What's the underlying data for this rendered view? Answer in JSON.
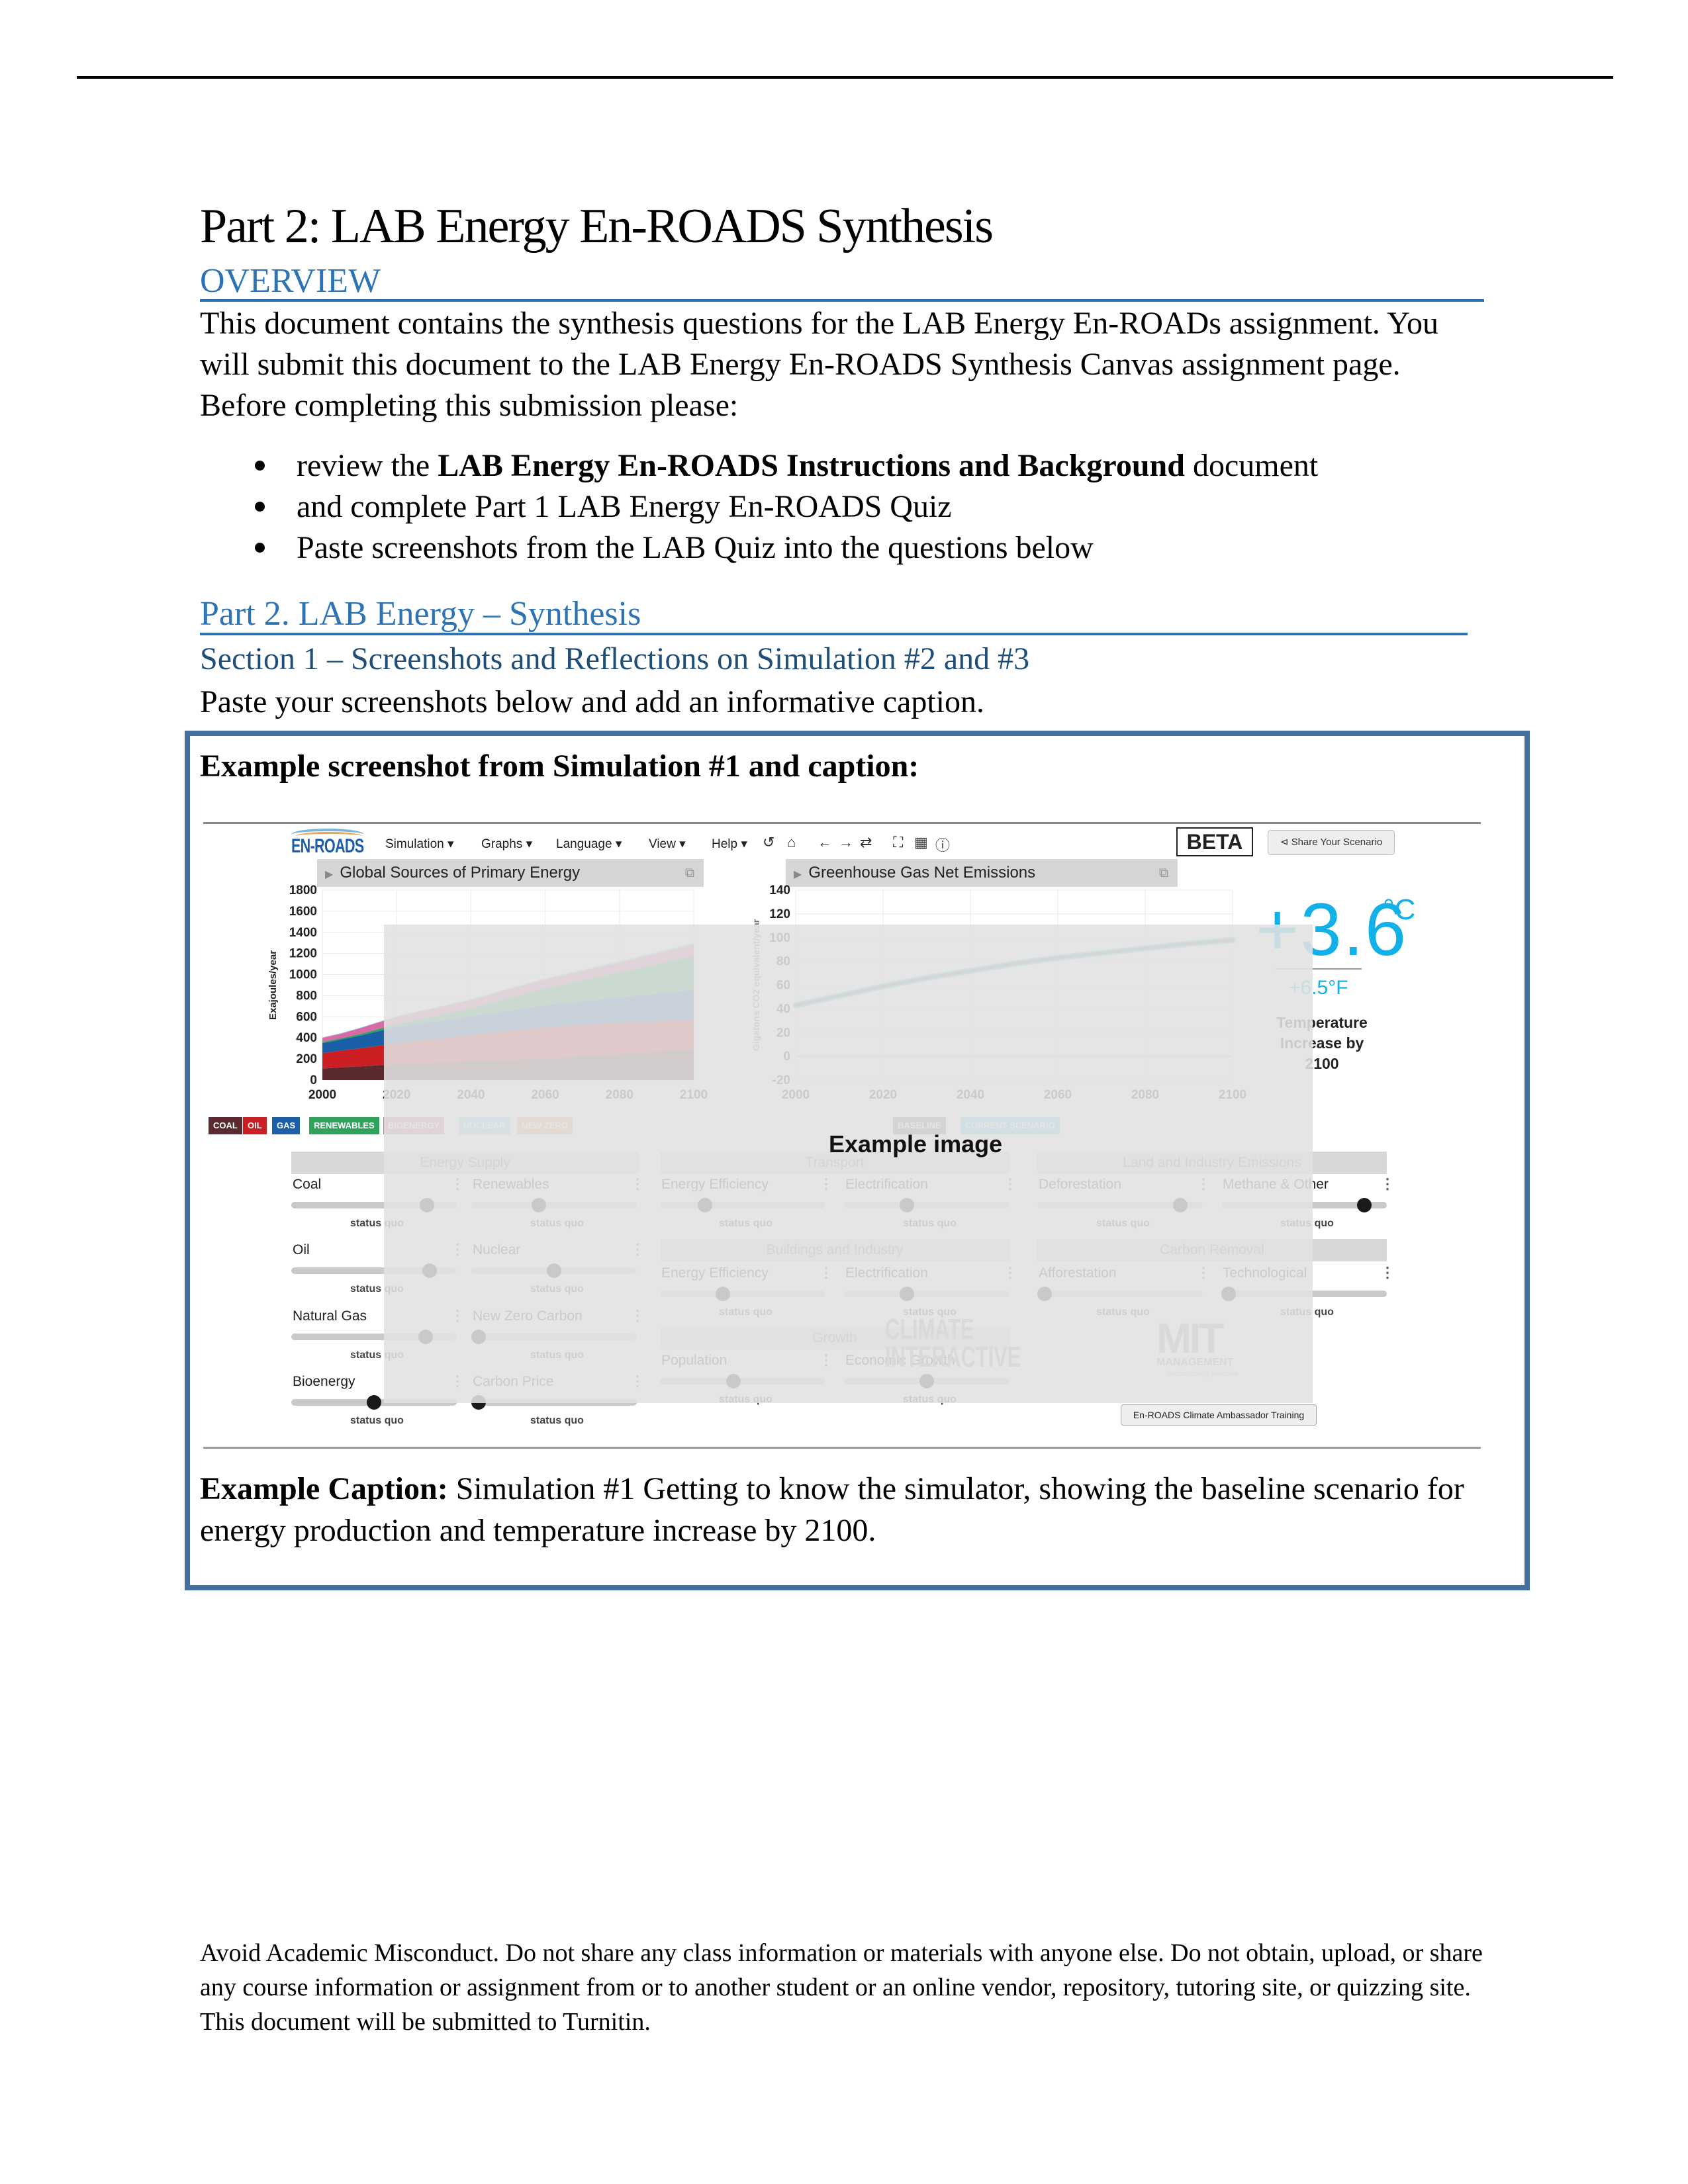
{
  "document": {
    "title": "Part 2: LAB Energy En-ROADS Synthesis",
    "overview_heading": "OVERVIEW",
    "overview_lines": [
      "This document contains the synthesis questions for the LAB Energy En-ROADs assignment. You",
      "will submit this document to the LAB Energy En-ROADS Synthesis Canvas assignment page.",
      "Before completing this submission please:"
    ],
    "bullets": [
      {
        "pre": "review the ",
        "bold": "LAB Energy En-ROADS Instructions and Background",
        "post": " document"
      },
      {
        "pre": "and complete Part 1 LAB Energy En-ROADS Quiz",
        "bold": "",
        "post": ""
      },
      {
        "pre": "Paste screenshots from the LAB Quiz into the questions below",
        "bold": "",
        "post": ""
      }
    ],
    "part2_heading": "Part 2. LAB Energy – Synthesis",
    "section1_heading": "Section 1 – Screenshots and Reflections on Simulation #2 and #3",
    "instruction": "Paste your screenshots below and add an informative caption.",
    "box": {
      "heading": "Example screenshot from Simulation #1 and caption:",
      "caption_label": "Example Caption:",
      "caption_text": " Simulation #1 Getting to know the simulator, showing the baseline scenario for energy production and temperature increase by 2100."
    },
    "footer": "Avoid Academic Misconduct. Do not share any class information or materials with anyone else. Do not obtain, upload, or share any course information or assignment from or to another student or an online vendor, repository, tutoring site, or quizzing site. This document will be submitted to Turnitin."
  },
  "screenshot": {
    "logo": "EN-ROADS",
    "menus": [
      "Simulation ▾",
      "Graphs ▾",
      "Language ▾",
      "View ▾",
      "Help ▾"
    ],
    "toolbar_icons": [
      {
        "name": "undo-icon",
        "glyph": "↺"
      },
      {
        "name": "home-icon",
        "glyph": "⌂"
      },
      {
        "name": "arrow-left-icon",
        "glyph": "←"
      },
      {
        "name": "arrow-right-icon",
        "glyph": "→"
      },
      {
        "name": "refresh-icon",
        "glyph": "⇄"
      },
      {
        "name": "fullscreen-icon",
        "glyph": "⛶"
      },
      {
        "name": "grid-icon",
        "glyph": "▦"
      },
      {
        "name": "info-icon",
        "glyph": "ⓘ"
      }
    ],
    "beta": "BETA",
    "share_button": "Share Your Scenario",
    "example_watermark": "Example image",
    "temperature": {
      "celsius": "+3.6",
      "celsius_unit": "°C",
      "fahrenheit": "+6.5°F",
      "label": "Temperature Increase by 2100"
    },
    "legend_energy": [
      {
        "label": "COAL",
        "color": "#5a2a2e"
      },
      {
        "label": "OIL",
        "color": "#cc1f24"
      },
      {
        "label": "GAS",
        "color": "#1b5fa8"
      },
      {
        "label": "RENEWABLES",
        "color": "#2fa35a"
      },
      {
        "label": "BIOENERGY",
        "color": "#d96aa6"
      },
      {
        "label": "NUCLEAR",
        "color": "#8dd3e6"
      },
      {
        "label": "NEW ZERO",
        "color": "#f29b5c"
      }
    ],
    "legend_emissions": [
      {
        "label": "BASELINE",
        "color": "#6e6e6e"
      },
      {
        "label": "CURRENT SCENARIO",
        "color": "#5cc3ea"
      }
    ],
    "groups": [
      {
        "title": "Energy Supply",
        "controls": [
          {
            "label": "Coal",
            "status": "status quo",
            "value": 0.85
          },
          {
            "label": "Renewables",
            "status": "status quo",
            "value": 0.4
          },
          {
            "label": "Oil",
            "status": "status quo",
            "value": 0.87
          },
          {
            "label": "Nuclear",
            "status": "status quo",
            "value": 0.5
          },
          {
            "label": "Natural Gas",
            "status": "status quo",
            "value": 0.84
          },
          {
            "label": "New Zero Carbon",
            "status": "status quo",
            "value": 0.0
          },
          {
            "label": "Bioenergy",
            "status": "status quo",
            "value": 0.5
          },
          {
            "label": "Carbon Price",
            "status": "status quo",
            "value": 0.0
          }
        ]
      },
      {
        "title": "Transport",
        "controls": [
          {
            "label": "Energy Efficiency",
            "status": "status quo",
            "value": 0.25
          },
          {
            "label": "Electrification",
            "status": "status quo",
            "value": 0.37
          }
        ]
      },
      {
        "title": "Buildings and Industry",
        "controls": [
          {
            "label": "Energy Efficiency",
            "status": "status quo",
            "value": 0.37
          },
          {
            "label": "Electrification",
            "status": "status quo",
            "value": 0.37
          }
        ]
      },
      {
        "title": "Growth",
        "controls": [
          {
            "label": "Population",
            "status": "status quo",
            "value": 0.44
          },
          {
            "label": "Economic Growth",
            "status": "status quo",
            "value": 0.5
          }
        ]
      },
      {
        "title": "Land and Industry Emissions",
        "controls": [
          {
            "label": "Deforestation",
            "status": "status quo",
            "value": 0.9
          },
          {
            "label": "Methane & Other",
            "status": "status quo",
            "value": 0.9
          }
        ]
      },
      {
        "title": "Carbon Removal",
        "controls": [
          {
            "label": "Afforestation",
            "status": "status quo",
            "value": 0.0
          },
          {
            "label": "Technological",
            "status": "status quo",
            "value": 0.0
          }
        ]
      }
    ],
    "logos": {
      "climate_interactive": "CLIMATE INTERACTIVE",
      "mit": "MIT",
      "mit_sub": "MANAGEMENT",
      "mit_sub2": "Sustainability Initiative"
    },
    "ambassador_button": "En-ROADS Climate Ambassador Training"
  },
  "chart_data": [
    {
      "type": "area",
      "title": "Global Sources of Primary Energy",
      "xlabel": "",
      "ylabel": "Exajoules/year",
      "x": [
        2000,
        2005,
        2010,
        2020,
        2040,
        2060,
        2080,
        2100
      ],
      "xticks": [
        "2000",
        "2020",
        "2040",
        "2060",
        "2080",
        "2100"
      ],
      "yticks": [
        "1800",
        "1600",
        "1400",
        "1200",
        "1000",
        "800",
        "600",
        "400",
        "200",
        "0"
      ],
      "xlim": [
        2000,
        2100
      ],
      "ylim": [
        0,
        1800
      ],
      "stacked": true,
      "series": [
        {
          "name": "Coal",
          "values": [
            110,
            120,
            130,
            150,
            175,
            205,
            245,
            290
          ]
        },
        {
          "name": "Oil",
          "values": [
            145,
            160,
            170,
            200,
            255,
            295,
            300,
            285
          ]
        },
        {
          "name": "Gas",
          "values": [
            95,
            105,
            120,
            155,
            175,
            210,
            240,
            280
          ]
        },
        {
          "name": "Renewables",
          "values": [
            10,
            12,
            15,
            25,
            75,
            160,
            235,
            320
          ]
        },
        {
          "name": "Bioenergy",
          "values": [
            40,
            43,
            55,
            70,
            80,
            85,
            95,
            110
          ]
        },
        {
          "name": "Nuclear",
          "values": [
            5,
            5,
            5,
            6,
            8,
            10,
            12,
            15
          ]
        }
      ],
      "grid": true,
      "legend": "bottom"
    },
    {
      "type": "line",
      "title": "Greenhouse Gas Net Emissions",
      "xlabel": "",
      "ylabel": "Gigatons CO2 equivalent/year",
      "x": [
        2000,
        2010,
        2020,
        2030,
        2040,
        2050,
        2060,
        2070,
        2080,
        2090,
        2100
      ],
      "xticks": [
        "2000",
        "2020",
        "2040",
        "2060",
        "2080",
        "2100"
      ],
      "yticks": [
        "140",
        "120",
        "100",
        "80",
        "60",
        "40",
        "20",
        "0",
        "-20"
      ],
      "xlim": [
        2000,
        2100
      ],
      "ylim": [
        -20,
        140
      ],
      "series": [
        {
          "name": "Baseline",
          "values": [
            43,
            51,
            59,
            66,
            72,
            78,
            83,
            87,
            91,
            95,
            98
          ]
        },
        {
          "name": "Current Scenario",
          "values": [
            43,
            51,
            59,
            66,
            72,
            78,
            83,
            87,
            91,
            95,
            98
          ]
        }
      ],
      "grid": true,
      "legend": "bottom"
    }
  ]
}
